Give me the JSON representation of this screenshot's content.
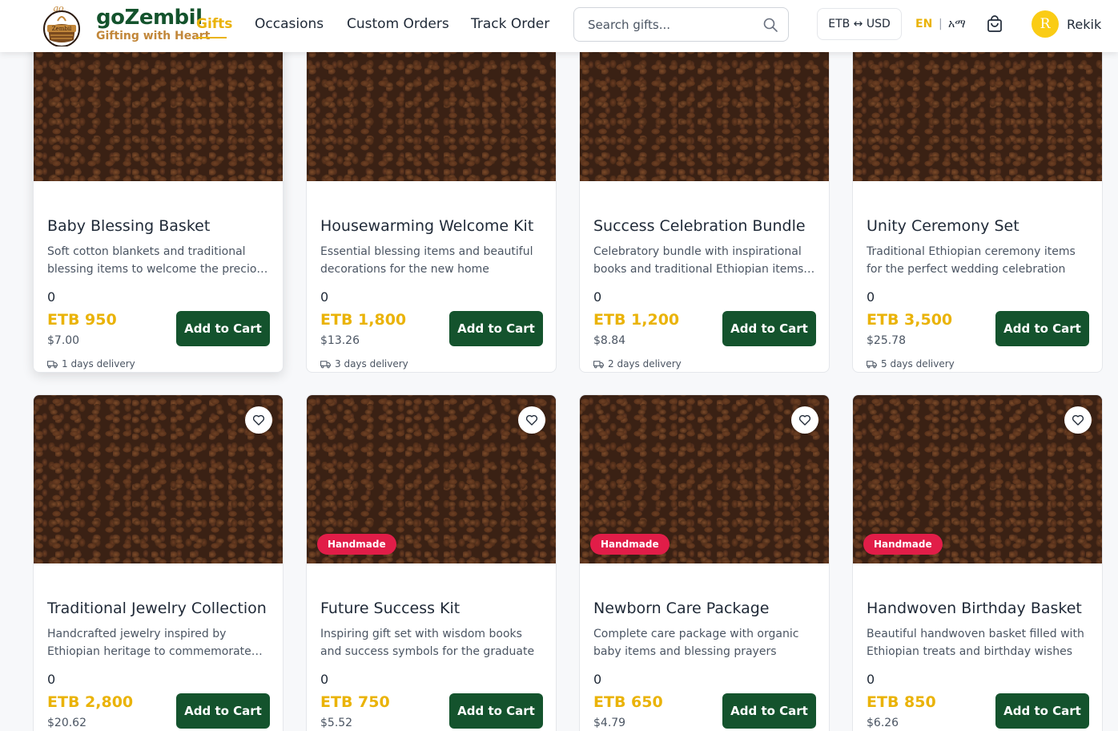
{
  "header": {
    "brand_name": "goZembil",
    "brand_tagline": "Gifting with Heart",
    "logo_text_top": "go",
    "logo_text_band": "Zembil",
    "nav": [
      "Gifts",
      "Occasions",
      "Custom Orders",
      "Track Order"
    ],
    "active_nav": "Gifts",
    "search_placeholder": "Search gifts...",
    "currency_toggle": "ETB ↔ USD",
    "lang_en": "EN",
    "lang_sep": "|",
    "lang_am": "አማ",
    "user_initial": "R",
    "user_name": "Rekik",
    "accent_color": "#eab308",
    "brand_color": "#14532d"
  },
  "products": [
    {
      "title": "Baby Blessing Basket",
      "desc": "Soft cotton blankets and traditional blessing items to welcome the precious new arrival",
      "count": "0",
      "price": "ETB 950",
      "usd": "$7.00",
      "delivery": "1 days delivery",
      "badge": "",
      "button": "Add to Cart"
    },
    {
      "title": "Housewarming Welcome Kit",
      "desc": "Essential blessing items and beautiful decorations for the new home",
      "count": "0",
      "price": "ETB 1,800",
      "usd": "$13.26",
      "delivery": "3 days delivery",
      "badge": "",
      "button": "Add to Cart"
    },
    {
      "title": "Success Celebration Bundle",
      "desc": "Celebratory bundle with inspirational books and traditional Ethiopian items for success",
      "count": "0",
      "price": "ETB 1,200",
      "usd": "$8.84",
      "delivery": "2 days delivery",
      "badge": "",
      "button": "Add to Cart"
    },
    {
      "title": "Unity Ceremony Set",
      "desc": "Traditional Ethiopian ceremony items for the perfect wedding celebration",
      "count": "0",
      "price": "ETB 3,500",
      "usd": "$25.78",
      "delivery": "5 days delivery",
      "badge": "",
      "button": "Add to Cart"
    },
    {
      "title": "Traditional Jewelry Collection",
      "desc": "Handcrafted jewelry inspired by Ethiopian heritage to commemorate milestones",
      "count": "0",
      "price": "ETB 2,800",
      "usd": "$20.62",
      "delivery": "",
      "badge": "",
      "button": "Add to Cart"
    },
    {
      "title": "Future Success Kit",
      "desc": "Inspiring gift set with wisdom books and success symbols for the graduate",
      "count": "0",
      "price": "ETB 750",
      "usd": "$5.52",
      "delivery": "",
      "badge": "Handmade",
      "button": "Add to Cart"
    },
    {
      "title": "Newborn Care Package",
      "desc": "Complete care package with organic baby items and blessing prayers",
      "count": "0",
      "price": "ETB 650",
      "usd": "$4.79",
      "delivery": "",
      "badge": "Handmade",
      "button": "Add to Cart"
    },
    {
      "title": "Handwoven Birthday Basket",
      "desc": "Beautiful handwoven basket filled with Ethiopian treats and birthday wishes",
      "count": "0",
      "price": "ETB 850",
      "usd": "$6.26",
      "delivery": "",
      "badge": "Handmade",
      "button": "Add to Cart"
    }
  ]
}
